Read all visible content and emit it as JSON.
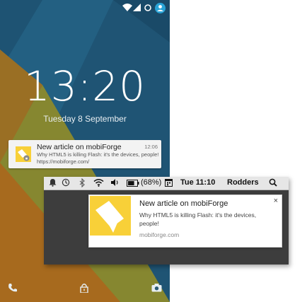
{
  "android": {
    "clock": "13:20",
    "date": "Tuesday 8 September",
    "notification": {
      "title": "New article on mobiForge",
      "time": "12:06",
      "body": "Why HTML5 is killing Flash: it's the devices, people!",
      "url": "https://mobiforge.com/"
    },
    "icons": {
      "status": [
        "wifi-icon",
        "signal-icon",
        "sync-icon",
        "account-icon"
      ],
      "bottom": [
        "phone-icon",
        "lock-icon",
        "camera-icon"
      ]
    }
  },
  "mac": {
    "menubar": {
      "battery": "(68%)",
      "clock": "Tue 11:10",
      "user": "Rodders",
      "icons": [
        "notification-icon",
        "time-machine-icon",
        "bluetooth-icon",
        "wifi-icon",
        "volume-icon",
        "battery-icon",
        "calendar-icon",
        "spotlight-icon"
      ]
    },
    "notification": {
      "title": "New article on mobiForge",
      "body": "Why HTML5 is killing Flash: it's the devices, people!",
      "url": "mobiforge.com",
      "close": "×"
    }
  },
  "colors": {
    "android_bg": "#1f5474",
    "android_shape_orange": "#a76a1e",
    "android_shape_olive": "#868730",
    "mobiforge_yellow": "#f8d038",
    "mac_bg": "#3d3d3d"
  }
}
